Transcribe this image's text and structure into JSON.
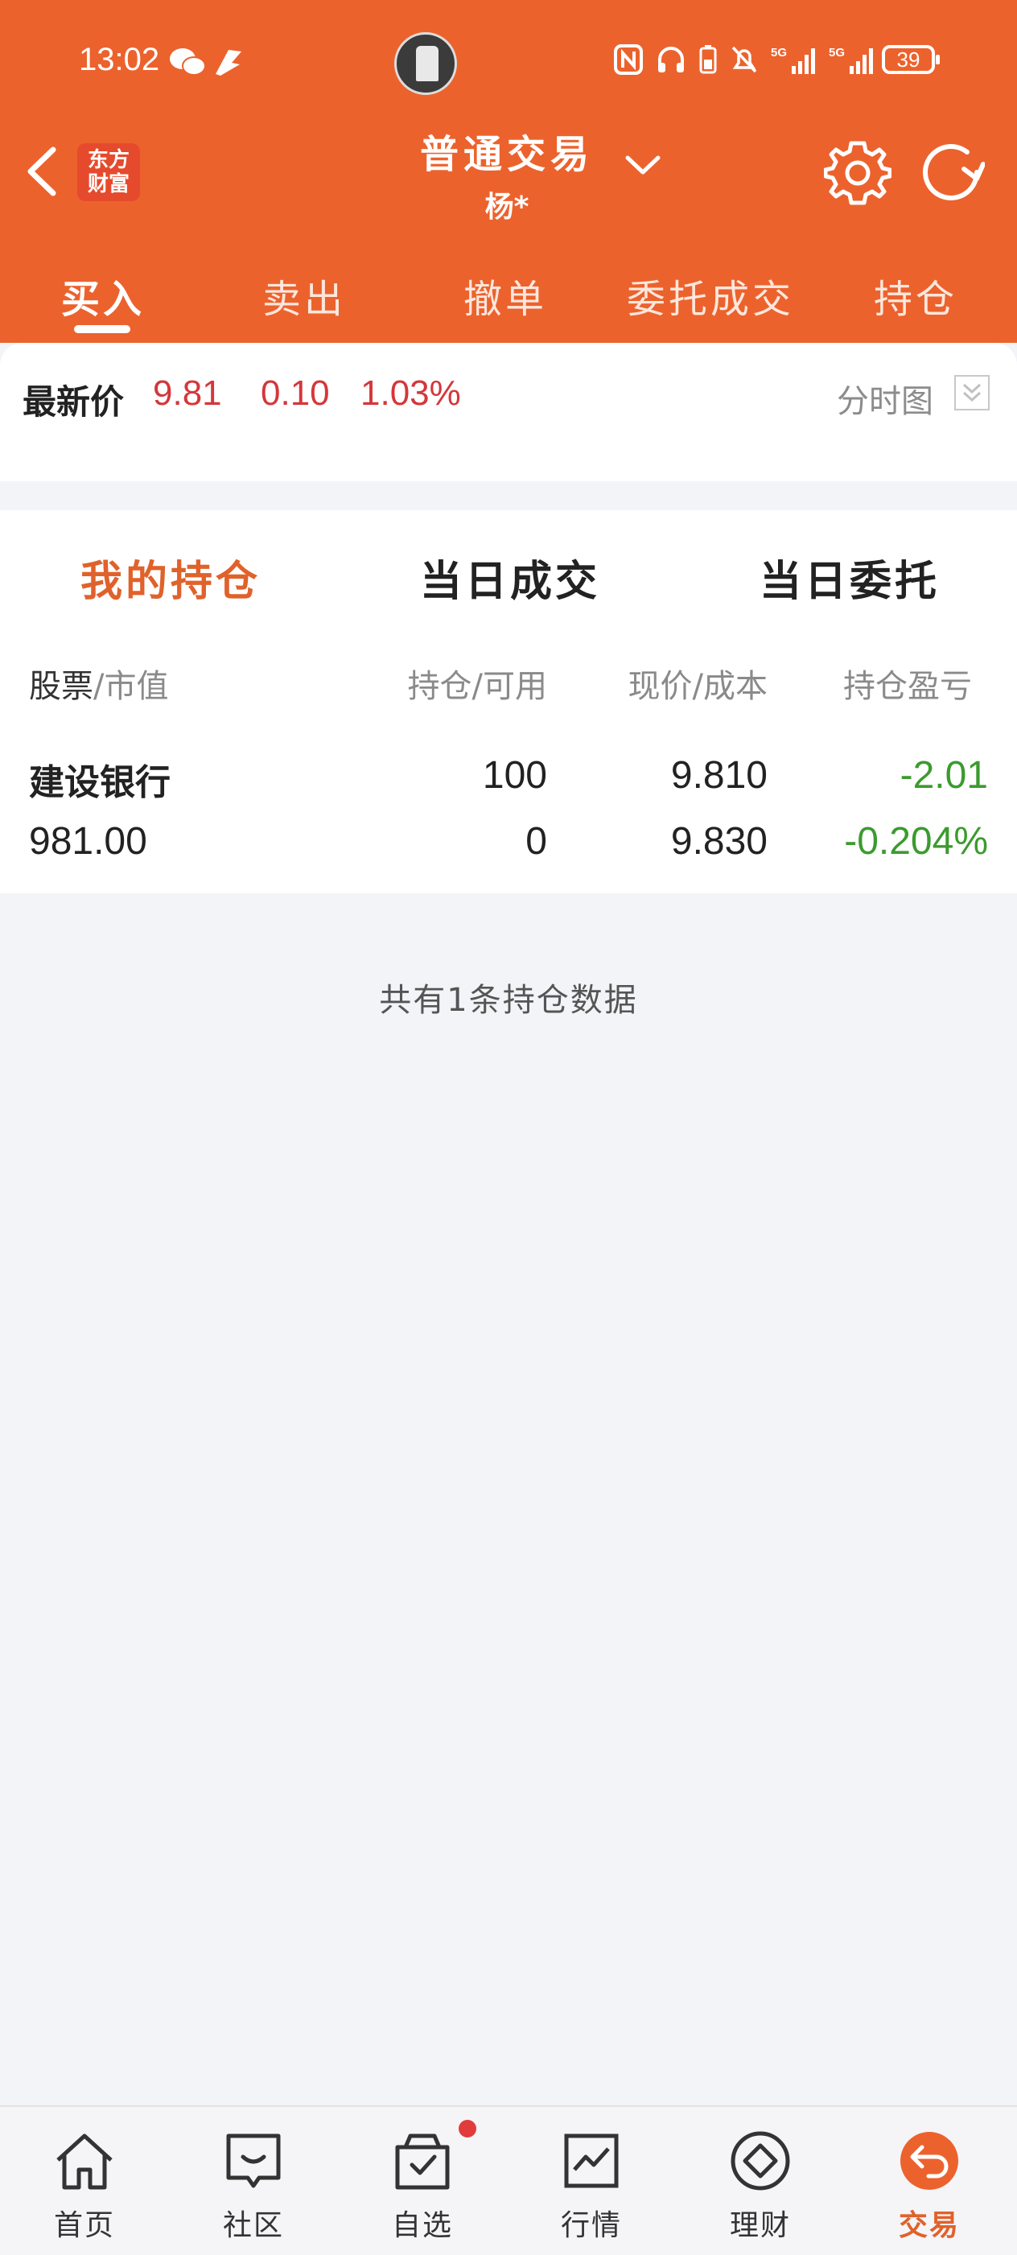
{
  "status_bar": {
    "time": "13:02",
    "battery": "39"
  },
  "header": {
    "logo_line1": "东方",
    "logo_line2": "财富",
    "title": "普通交易",
    "subtitle": "杨*"
  },
  "tabs": [
    "买入",
    "卖出",
    "撤单",
    "委托成交",
    "持仓"
  ],
  "price_bar": {
    "label": "最新价",
    "price": "9.81",
    "change": "0.10",
    "change_pct": "1.03%",
    "chart_toggle": "分时图"
  },
  "sub_tabs": [
    "我的持仓",
    "当日成交",
    "当日委托"
  ],
  "columns": {
    "stock": "股票",
    "market_value": "/市值",
    "position": "持仓/可用",
    "price_cost": "现价/成本",
    "pnl": "持仓盈亏"
  },
  "holdings": [
    {
      "name": "建设银行",
      "market_value": "981.00",
      "position": "100",
      "available": "0",
      "current_price": "9.810",
      "cost": "9.830",
      "pnl": "-2.01",
      "pnl_pct": "-0.204%"
    }
  ],
  "summary": "共有1条持仓数据",
  "bottom_nav": [
    "首页",
    "社区",
    "自选",
    "行情",
    "理财",
    "交易"
  ],
  "colors": {
    "brand": "#ec622d",
    "up": "#d4373a",
    "down": "#3b9b2e"
  }
}
